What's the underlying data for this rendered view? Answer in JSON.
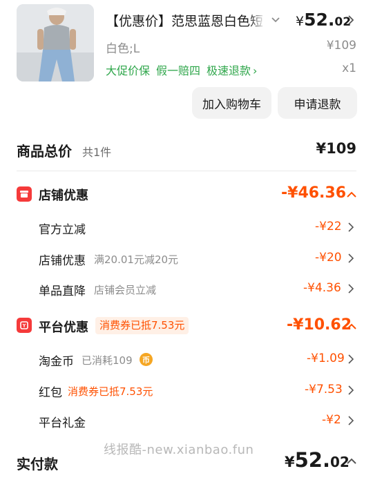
{
  "product": {
    "title": "【优惠价】范思蓝恩白色短袖",
    "price_symbol": "¥",
    "price_int": "52.",
    "price_dec": "02",
    "spec": "白色;L",
    "original_price": "¥109",
    "tags": [
      "大促价保",
      "假一赔四",
      "极速退款"
    ],
    "quantity": "x1",
    "add_to_cart_label": "加入购物车",
    "refund_label": "申请退款"
  },
  "total": {
    "label": "商品总价",
    "count": "共1件",
    "value": "¥109"
  },
  "store_discount": {
    "label": "店铺优惠",
    "value": "-¥46.36",
    "items": [
      {
        "label": "官方立减",
        "sub": "",
        "value": "-¥22"
      },
      {
        "label": "店铺优惠",
        "sub": "满20.01元减20元",
        "value": "-¥20"
      },
      {
        "label": "单品直降",
        "sub": "店铺会员立减",
        "value": "-¥4.36"
      }
    ]
  },
  "platform_discount": {
    "label": "平台优惠",
    "badge": "消费券已抵7.53元",
    "value": "-¥10.62",
    "items": [
      {
        "label": "淘金币",
        "sub": "已消耗109",
        "value": "-¥1.09"
      },
      {
        "label": "红包",
        "sub": "消费券已抵7.53元",
        "value": "-¥7.53"
      },
      {
        "label": "平台礼金",
        "sub": "",
        "value": "-¥2"
      }
    ]
  },
  "coin_icon_text": "币",
  "watermark": "线报酷-new.xianbao.fun",
  "payment": {
    "label": "实付款",
    "symbol": "¥",
    "int": "52.",
    "dec": "02"
  },
  "colors": {
    "accent": "#ff5000",
    "green": "#2ea64a",
    "icon_red": "#f53a3a"
  }
}
